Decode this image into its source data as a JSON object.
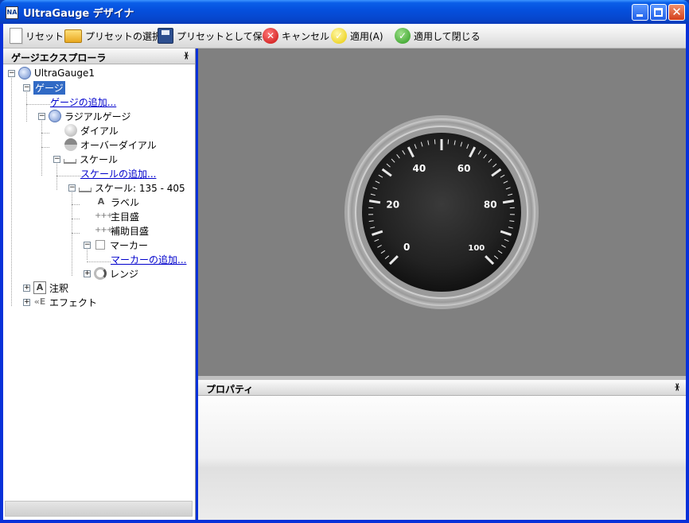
{
  "window": {
    "app_icon": "NA",
    "title": "UltraGauge デザイナ",
    "min_glyph": "",
    "max_glyph": "",
    "close_glyph": "✕"
  },
  "toolbar": {
    "reset": "リセット",
    "select_preset": "プリセットの選択",
    "save_preset": "プリセットとして保存",
    "cancel": "キャンセル",
    "apply": "適用(A)",
    "apply_close": "適用して閉じる"
  },
  "explorer": {
    "title": "ゲージエクスプローラ",
    "pin": "ᚕ",
    "tree": {
      "root": "UltraGauge1",
      "gauges": "ゲージ",
      "add_gauge": "ゲージの追加...",
      "radial_gauge": "ラジアルゲージ",
      "dial": "ダイアル",
      "over_dial": "オーバーダイアル",
      "scales": "スケール",
      "add_scale": "スケールの追加...",
      "scale_item": "スケール: 135 - 405",
      "labels": "ラベル",
      "major_ticks": "主目盛",
      "minor_ticks": "補助目盛",
      "markers": "マーカー",
      "add_marker": "マーカーの追加...",
      "ranges": "レンジ",
      "annotations": "注釈",
      "effects": "エフェクト"
    }
  },
  "gauge": {
    "labels": [
      "0",
      "20",
      "40",
      "60",
      "80",
      "100"
    ],
    "colors": {
      "face": "#1c1c1c",
      "bezel": "#b8b8b8",
      "background": "#808080"
    }
  },
  "properties": {
    "title": "プロパティ",
    "pin": "ᚕ"
  },
  "icons": {
    "reset": "document-icon",
    "select_preset": "folder-open-icon",
    "save_preset": "floppy-disk-icon",
    "cancel": "cancel-x-icon",
    "apply": "apply-check-icon",
    "apply_close": "apply-close-check-icon"
  }
}
